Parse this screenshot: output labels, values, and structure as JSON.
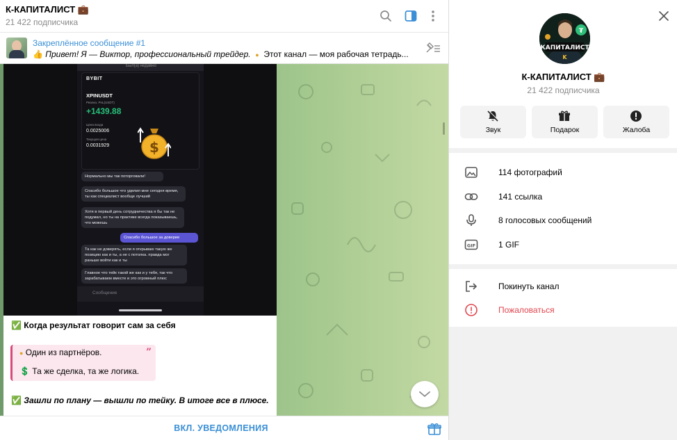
{
  "chat": {
    "title": "К-КАПИТАЛИСТ 💼",
    "subtitle": "21 422 подписчика",
    "header_icons": [
      "search-icon",
      "sidebar-toggle-icon",
      "more-vertical-icon"
    ]
  },
  "pinned": {
    "label": "Закреплённое сообщение #1",
    "text_emoji": "👍",
    "text_main": "Привет! Я — Виктор, профессиональный трейдер.",
    "text_bullet": "●",
    "text_rest": "Этот канал — моя рабочая тетрадь..."
  },
  "screenshot": {
    "status": "Был(а) недавно",
    "exchange": "BYBIT",
    "pair": "XPINUSDT",
    "pnl_label": "Реализ. PnL(USDT)",
    "pnl": "+1439.88",
    "entry_label": "Цена входа",
    "entry_value": "0.0025006",
    "current_label": "Текущая цена",
    "current_value": "0.0031929",
    "messages": [
      {
        "text": "Нормально мы так поторговали!",
        "own": false
      },
      {
        "text": "Спасибо большое что уделил мне сегодня время, ты как специалист вообще лучший",
        "own": false
      },
      {
        "text": "Хотя в первый день сотрудничества я бы так не подумал, но ты на практике всегда показываешь, что можешь",
        "own": false
      },
      {
        "text": "Спасибо большое за доверие",
        "own": true
      },
      {
        "text": "Та как не доверять, если я открываю такую же позицию как и ты, а не с потолка. правда мог раньше войти как и ты",
        "own": false
      },
      {
        "text": "Главное что тейк такой же как и у тебя, так что зарабатываем вместе и это огромный плюс",
        "own": false
      }
    ],
    "input_placeholder": "Сообщение"
  },
  "post": {
    "headline_emoji": "✅",
    "headline": "Когда результат говорит сам за себя",
    "quote_line1_emoji": "●",
    "quote_line1": "Один из партнёров.",
    "quote_line2_emoji": "💲",
    "quote_line2": "Та же сделка, та же логика.",
    "quote_mark": "”",
    "footer_emoji": "✅",
    "footer": "Зашли по плану — вышли по тейку. В итоге все в плюсе."
  },
  "bottom": {
    "button_label": "ВКЛ. УВЕДОМЛЕНИЯ"
  },
  "profile": {
    "avatar_text": "КАПИТАЛИСТ",
    "name": "К-КАПИТАЛИСТ 💼",
    "subtitle": "21 422 подписчика",
    "actions": [
      {
        "label": "Звук",
        "icon": "mute-bell-icon"
      },
      {
        "label": "Подарок",
        "icon": "gift-icon"
      },
      {
        "label": "Жалоба",
        "icon": "report-icon"
      }
    ],
    "media": [
      {
        "label": "114 фотографий",
        "icon": "photo-icon"
      },
      {
        "label": "141 ссылка",
        "icon": "link-icon"
      },
      {
        "label": "8 голосовых сообщений",
        "icon": "microphone-icon"
      },
      {
        "label": "1 GIF",
        "icon": "gif-icon"
      }
    ],
    "leave_label": "Покинуть канал",
    "report_label": "Пожаловаться"
  },
  "colors": {
    "accent": "#3a8fd6",
    "danger": "#e0464e",
    "quote_border": "#d94a7a",
    "pnl_green": "#27c07a"
  }
}
